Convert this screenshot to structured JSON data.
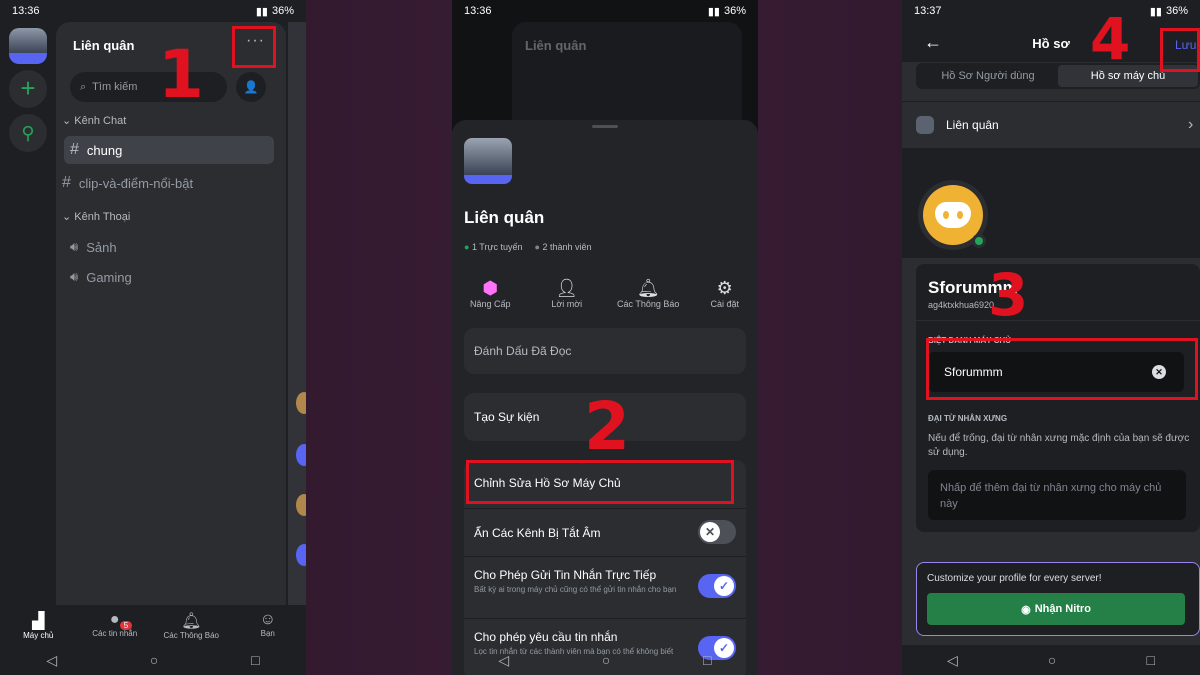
{
  "phone1": {
    "time": "13:36",
    "battery": "36%",
    "server_name": "Liên quân",
    "search_placeholder": "Tìm kiếm",
    "categories": [
      {
        "name": "Kênh Chat",
        "channels": [
          "chung",
          "clip-và-điểm-nổi-bật"
        ]
      },
      {
        "name": "Kênh Thoại",
        "channels": [
          "Sảnh",
          "Gaming"
        ]
      }
    ],
    "bottom_nav": [
      "Máy chủ",
      "Các tin nhắn",
      "Các Thông Báo",
      "Bạn"
    ],
    "messages_badge": "5",
    "step": "1"
  },
  "phone2": {
    "time": "13:36",
    "battery": "36%",
    "server_name": "Liên quân",
    "online": "1 Trực tuyến",
    "members": "2 thành viên",
    "actions": [
      "Nâng Cấp",
      "Lời mời",
      "Các Thông Báo",
      "Cài đặt"
    ],
    "mark_read": "Đánh Dấu Đã Đọc",
    "create_event": "Tạo Sự kiện",
    "edit_profile": "Chỉnh Sửa Hồ Sơ Máy Chủ",
    "hide_muted": "Ẩn Các Kênh Bị Tắt Âm",
    "allow_dm": "Cho Phép Gửi Tin Nhắn Trực Tiếp",
    "allow_dm_desc": "Bất kỳ ai trong máy chủ cũng có thể gửi tin nhắn cho bạn",
    "allow_requests": "Cho phép yêu cầu tin nhắn",
    "allow_requests_desc": "Lọc tin nhắn từ các thành viên mà bạn có thể không biết",
    "step": "2"
  },
  "phone3": {
    "time": "13:37",
    "battery": "36%",
    "title": "Hồ sơ",
    "save": "Lưu",
    "tab_user": "Hồ Sơ Người dùng",
    "tab_server": "Hồ sơ máy chủ",
    "server_name": "Liên quân",
    "display_name": "Sforummm",
    "username": "ag4ktxkhua6920",
    "nickname_label": "BIỆT DANH MÁY CHỦ",
    "nickname_value": "Sforummm",
    "pronoun_label": "ĐẠI TỪ NHÂN XƯNG",
    "pronoun_desc": "Nếu để trống, đại từ nhân xưng mặc định của bạn sẽ được sử dụng.",
    "pronoun_placeholder": "Nhấp để thêm đại từ nhân xưng cho máy chủ này",
    "nitro_promo": "Customize your profile for every server!",
    "nitro_button": "Nhận Nitro",
    "step3": "3",
    "step4": "4"
  }
}
